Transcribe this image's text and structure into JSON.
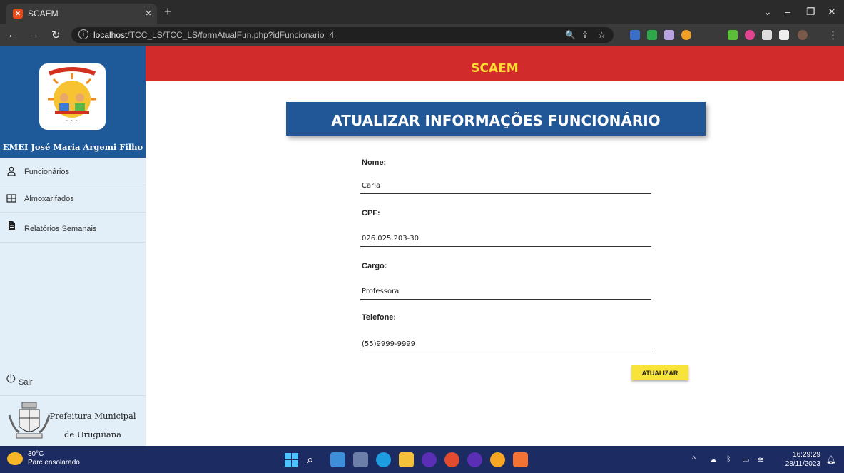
{
  "browser": {
    "tab_title": "SCAEM",
    "tab_favicon": "xampp-icon",
    "url_host": "localhost",
    "url_path": "/TCC_LS/TCC_LS/formAtualFun.php?idFuncionario=4"
  },
  "header": {
    "brand": "SCAEM"
  },
  "sidebar": {
    "school_name": "EMEI José Maria Argemi Filho",
    "items": [
      {
        "label": "Funcionários",
        "icon": "user-icon"
      },
      {
        "label": "Almoxarifados",
        "icon": "grid-icon"
      },
      {
        "label": "Relatórios Semanais",
        "icon": "document-icon"
      }
    ],
    "logout_label": "Sair",
    "prefeitura_line1": "Prefeitura Municipal",
    "prefeitura_line2": "de Uruguiana"
  },
  "form": {
    "title": "ATUALIZAR INFORMAÇÕES FUNCIONÁRIO",
    "fields": [
      {
        "label": "Nome:",
        "value": "Carla"
      },
      {
        "label": "CPF:",
        "value": "026.025.203-30"
      },
      {
        "label": "Cargo:",
        "value": "Professora"
      },
      {
        "label": "Telefone:",
        "value": "(55)9999-9999"
      }
    ],
    "submit_label": "ATUALIZAR"
  },
  "taskbar": {
    "weather_temp": "30°C",
    "weather_desc": "Parc ensolarado",
    "time": "16:29:29",
    "date": "28/11/2023"
  },
  "colors": {
    "header_red": "#d22b2b",
    "brand_yellow": "#ffdd33",
    "banner_blue": "#215796",
    "sidebar_blue": "#1e5a99",
    "button_yellow": "#f8e33a"
  }
}
